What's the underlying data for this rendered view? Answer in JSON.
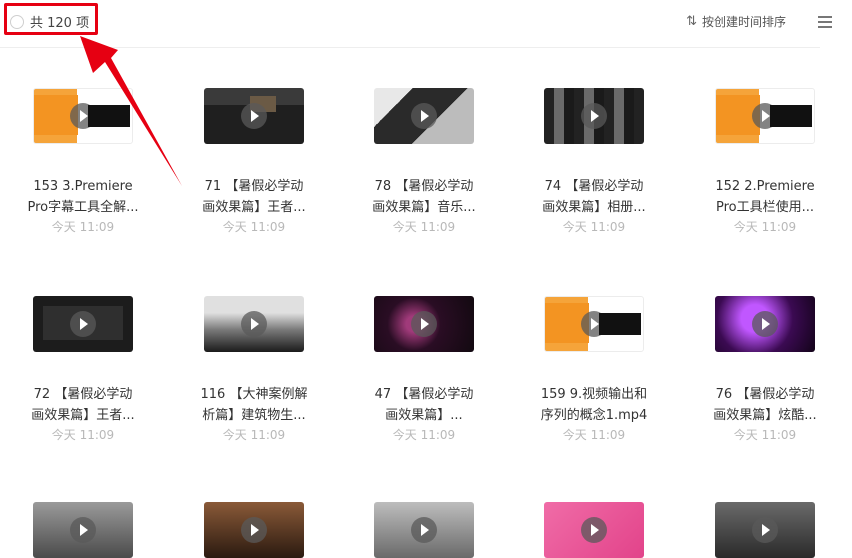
{
  "header": {
    "count_label": "共 120 项",
    "sort_label": "按创建时间排序",
    "highlight_color": "#e60012"
  },
  "items": [
    {
      "line1": "153 3.Premiere",
      "line2": "Pro字幕工具全解...",
      "date": "今天 11:09",
      "thumb": "orange"
    },
    {
      "line1": "71 【暑假必学动",
      "line2": "画效果篇】王者...",
      "date": "今天 11:09",
      "thumb": "editor"
    },
    {
      "line1": "78 【暑假必学动",
      "line2": "画效果篇】音乐...",
      "date": "今天 11:09",
      "thumb": "photo"
    },
    {
      "line1": "74 【暑假必学动",
      "line2": "画效果篇】相册...",
      "date": "今天 11:09",
      "thumb": "film"
    },
    {
      "line1": "152 2.Premiere",
      "line2": "Pro工具栏使用...",
      "date": "今天 11:09",
      "thumb": "orange"
    },
    {
      "line1": "72 【暑假必学动",
      "line2": "画效果篇】王者...",
      "date": "今天 11:09",
      "thumb": "dark"
    },
    {
      "line1": "116 【大神案例解",
      "line2": "析篇】建筑物生...",
      "date": "今天 11:09",
      "thumb": "sky"
    },
    {
      "line1": "47 【暑假必学动",
      "line2": "画效果篇】...",
      "date": "今天 11:09",
      "thumb": "space"
    },
    {
      "line1": "159 9.视频输出和",
      "line2": "序列的概念1.mp4",
      "date": "今天 11:09",
      "thumb": "orange"
    },
    {
      "line1": "76 【暑假必学动",
      "line2": "画效果篇】炫酷...",
      "date": "今天 11:09",
      "thumb": "purple"
    }
  ],
  "partial_thumbs": [
    "grey",
    "warm",
    "light",
    "pink",
    "gray2"
  ],
  "icons": {
    "sort": "sort-arrows-icon",
    "menu": "list-menu-icon",
    "play": "play-icon",
    "checkbox": "select-circle-icon"
  }
}
